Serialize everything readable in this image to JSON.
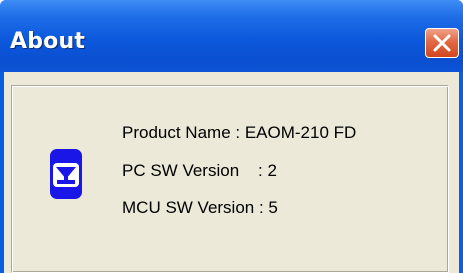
{
  "window": {
    "title": "About"
  },
  "about": {
    "product_name": "Product Name : EAOM-210 FD",
    "pc_sw_version": "PC SW Version    : 2",
    "mcu_sw_version": "MCU SW Version : 5"
  },
  "icons": {
    "close": "close-icon",
    "logo": "product-logo-icon"
  },
  "colors": {
    "titlebar": "#0A4FD0",
    "close_button": "#E06A45",
    "dialog_background": "#ECE9D8",
    "logo": "#1A16E8"
  }
}
